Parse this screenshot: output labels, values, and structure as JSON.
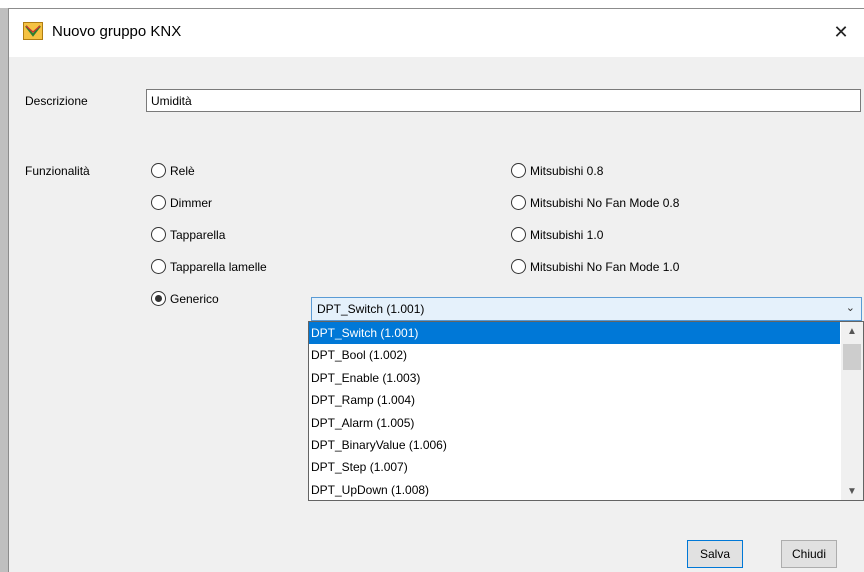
{
  "window": {
    "title": "Nuovo gruppo KNX",
    "close_glyph": "✕",
    "icon": "app-icon"
  },
  "form": {
    "descrizione_label": "Descrizione",
    "descrizione_value": "Umidità",
    "funzionalita_label": "Funzionalità"
  },
  "radios": {
    "rele": "Relè",
    "dimmer": "Dimmer",
    "tapparella": "Tapparella",
    "tapparella_lamelle": "Tapparella lamelle",
    "generico": "Generico",
    "mitsubishi_08": "Mitsubishi 0.8",
    "mitsubishi_nofan_08": "Mitsubishi No Fan Mode 0.8",
    "mitsubishi_10": "Mitsubishi 1.0",
    "mitsubishi_nofan_10": "Mitsubishi No Fan Mode 1.0",
    "selected": "generico"
  },
  "combo": {
    "value": "DPT_Switch (1.001)",
    "options": [
      "DPT_Switch (1.001)",
      "DPT_Bool (1.002)",
      "DPT_Enable (1.003)",
      "DPT_Ramp (1.004)",
      "DPT_Alarm (1.005)",
      "DPT_BinaryValue (1.006)",
      "DPT_Step (1.007)",
      "DPT_UpDown (1.008)"
    ],
    "highlighted_index": 0
  },
  "buttons": {
    "save": "Salva",
    "close": "Chiudi"
  },
  "colors": {
    "selection": "#0078d7",
    "combo_bg": "#e5f1fb",
    "dialog_bg": "#f0f0f0"
  }
}
